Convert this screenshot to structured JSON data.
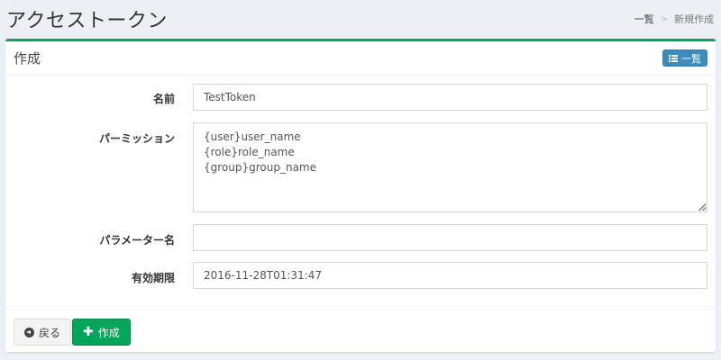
{
  "page": {
    "title": "アクセストークン",
    "breadcrumb": {
      "list": "一覧",
      "separator": ">",
      "current": "新規作成"
    }
  },
  "box": {
    "title": "作成",
    "list_button_label": "一覧",
    "accent_color": "#00a65a"
  },
  "form": {
    "name": {
      "label": "名前",
      "value": "TestToken"
    },
    "permission": {
      "label": "パーミッション",
      "value": "{user}user_name\n{role}role_name\n{group}group_name"
    },
    "param_name": {
      "label": "パラメーター名",
      "value": ""
    },
    "expiry": {
      "label": "有効期限",
      "value": "2016-11-28T01:31:47"
    }
  },
  "footer": {
    "back_label": "戻る",
    "create_label": "作成"
  },
  "icons": {
    "list_button": "list-icon",
    "back_button": "circle-arrow-left-icon",
    "create_button": "plus-icon"
  }
}
